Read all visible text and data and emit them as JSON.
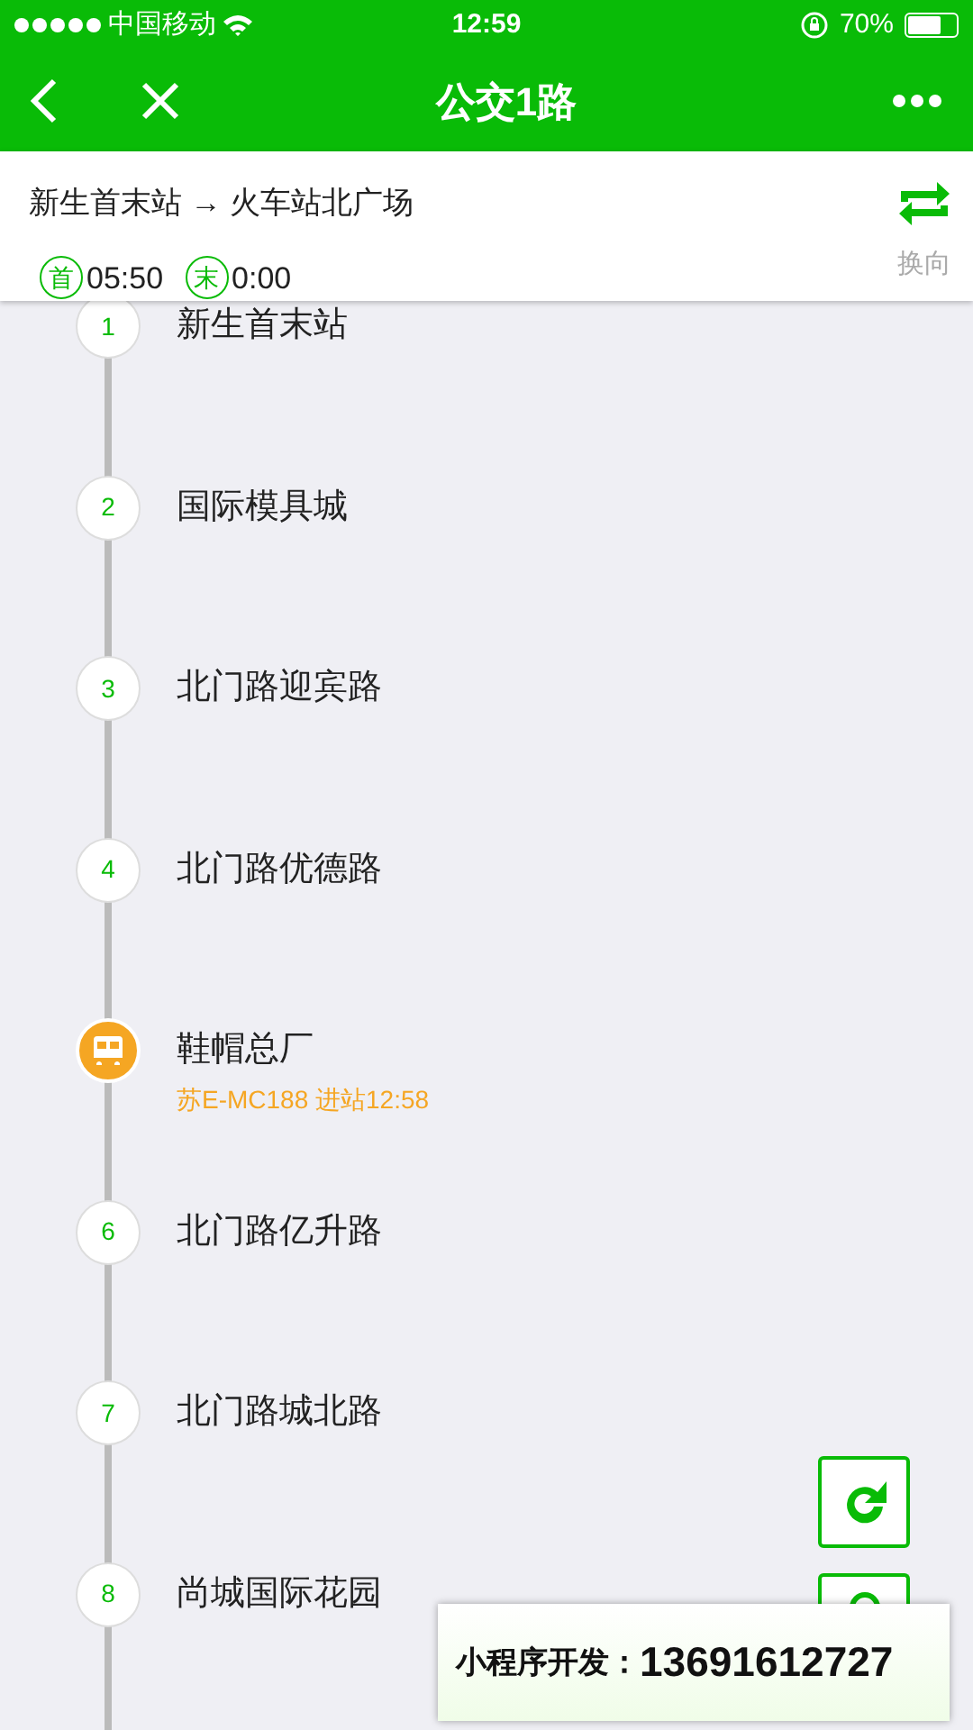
{
  "status_bar": {
    "carrier": "中国移动",
    "time": "12:59",
    "battery": "70%"
  },
  "nav": {
    "title": "公交1路"
  },
  "route": {
    "from_to": "新生首末站 → 火车站北广场",
    "first_label": "首",
    "first_time": "05:50",
    "last_label": "末",
    "last_time": "0:00",
    "swap_label": "换向"
  },
  "stops": [
    {
      "kind": "stop",
      "number": "1",
      "name": "新生首末站"
    },
    {
      "kind": "stop",
      "number": "2",
      "name": "国际模具城"
    },
    {
      "kind": "stop",
      "number": "3",
      "name": "北门路迎宾路"
    },
    {
      "kind": "stop",
      "number": "4",
      "name": "北门路优德路"
    },
    {
      "kind": "bus",
      "name": "鞋帽总厂",
      "bus_info": "苏E-MC188 进站12:58"
    },
    {
      "kind": "stop",
      "number": "6",
      "name": "北门路亿升路"
    },
    {
      "kind": "stop",
      "number": "7",
      "name": "北门路城北路"
    },
    {
      "kind": "stop",
      "number": "8",
      "name": "尚城国际花园"
    }
  ],
  "banner": {
    "label": "小程序开发：",
    "phone": "13691612727"
  }
}
